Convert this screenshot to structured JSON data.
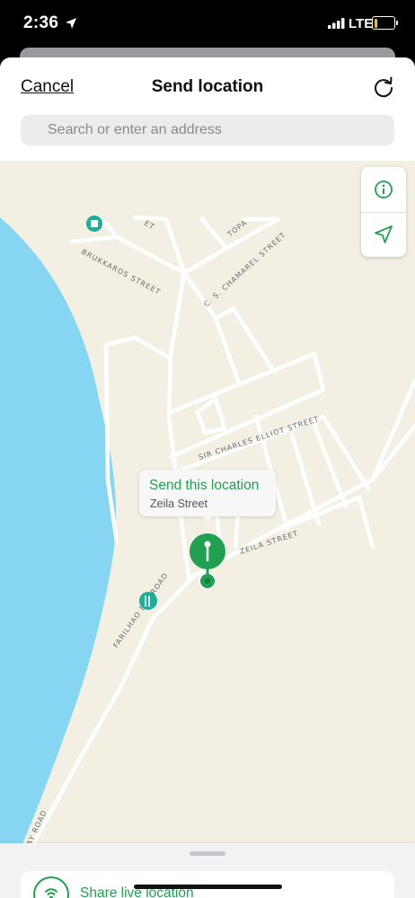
{
  "status_bar": {
    "time": "2:36",
    "network": "LTE",
    "icons": [
      "location-arrow-icon",
      "signal-bars-icon",
      "battery-icon"
    ]
  },
  "header": {
    "cancel_label": "Cancel",
    "title": "Send location",
    "refresh_icon": "refresh-icon"
  },
  "search": {
    "placeholder": "Search or enter an address",
    "value": ""
  },
  "map": {
    "street_labels": [
      "BRUKKAROS STREET",
      "C. S. CHAMAREL STREET",
      "TOPA",
      "SIR CHARLES ELLIOT STREET",
      "ZEILA STREET",
      "FARILHAO BAY ROAD",
      "FARILHAO BAY ROAD",
      "ET"
    ],
    "poi_icons": [
      "shop-poi-icon",
      "restaurant-poi-icon"
    ],
    "controls": [
      "info-icon",
      "current-location-icon"
    ],
    "colors": {
      "land": "#f3efe2",
      "water": "#86d6f3",
      "road": "#ffffff",
      "accent": "#20a050"
    }
  },
  "callout": {
    "title": "Send this location",
    "subtitle": "Zeila Street"
  },
  "bottom_sheet": {
    "live_label": "Share live location",
    "live_icon": "live-location-icon"
  }
}
